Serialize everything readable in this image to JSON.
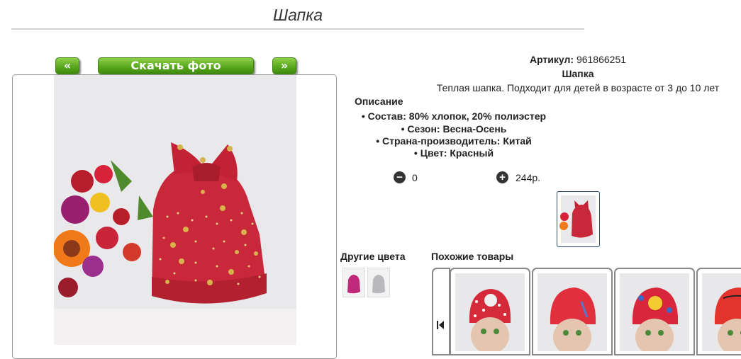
{
  "page": {
    "title": "Шапка"
  },
  "gallery": {
    "prev_label": "«",
    "download_label": "Скачать фото",
    "next_label": "»"
  },
  "product": {
    "sku_label": "Артикул:",
    "sku_value": "961866251",
    "name": "Шапка",
    "description": "Теплая шапка. Подходит для детей в возрасте от 3 до 10 лет",
    "desc_heading": "Описание",
    "specs": [
      "• Состав: 80% хлопок, 20% полиэстер",
      "• Сезон: Весна-Осень",
      "• Страна-производитель: Китай",
      "• Цвет: Красный"
    ],
    "qty": "0",
    "price": "244р."
  },
  "sections": {
    "other_colors": "Другие цвета",
    "similar": "Похожие товары"
  },
  "colors": {
    "accent_green": "#5aa81e",
    "hat_red": "#c8283a"
  },
  "icons": [
    "minus-circle-icon",
    "plus-circle-icon",
    "carousel-first-icon"
  ]
}
